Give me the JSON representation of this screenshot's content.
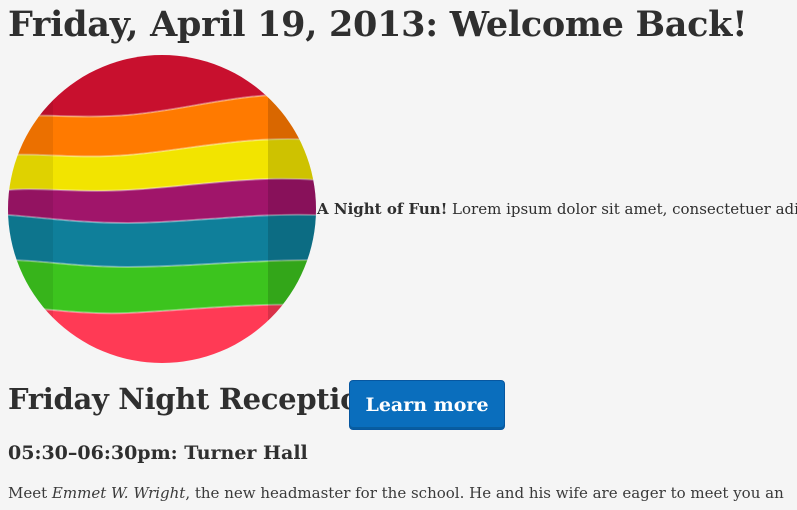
{
  "page": {
    "title": "Friday, April 19, 2013: Welcome Back!"
  },
  "hero": {
    "image_name": "rainbow-ribbon-sphere",
    "stripe_colors": [
      "#c8102e",
      "#ff7a00",
      "#f2e400",
      "#a0156a",
      "#0f7f9a",
      "#3cc41e",
      "#ff3a55"
    ],
    "lead_bold": "A Night of Fun!",
    "lead_text": " Lorem ipsum dolor sit amet, consectetuer adi"
  },
  "section": {
    "title": "Friday Night Reception",
    "button_label": "Learn more",
    "button_color": "#0a6ebd"
  },
  "event": {
    "time_location": "05:30–06:30pm: Turner Hall",
    "desc_before": "Meet ",
    "desc_name": "Emmet W. Wright",
    "desc_after": ", the new headmaster for the school. He and his wife are eager to meet you an"
  }
}
